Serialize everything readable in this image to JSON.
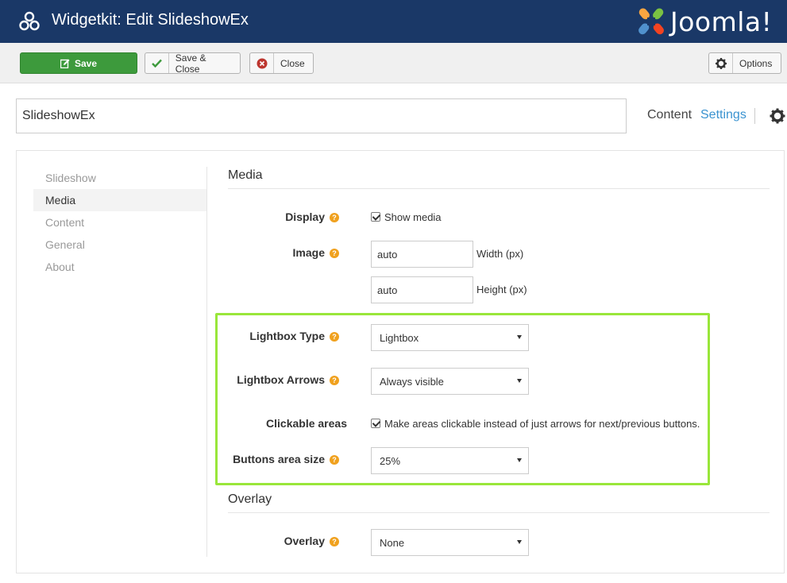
{
  "header": {
    "title": "Widgetkit: Edit SlideshowEx",
    "logo_text": "Joomla!",
    "colors": {
      "bar": "#1a3867",
      "save": "#3d9a3c",
      "link": "#3a93d0",
      "highlight": "#99e63a",
      "help": "#f0a11e"
    }
  },
  "toolbar": {
    "save_label": "Save",
    "save_close_label": "Save & Close",
    "close_label": "Close",
    "options_label": "Options"
  },
  "widget": {
    "name": "SlideshowEx"
  },
  "tabs": {
    "content": "Content",
    "settings": "Settings"
  },
  "sidebar": {
    "items": [
      {
        "label": "Slideshow"
      },
      {
        "label": "Media"
      },
      {
        "label": "Content"
      },
      {
        "label": "General"
      },
      {
        "label": "About"
      }
    ]
  },
  "media": {
    "title": "Media",
    "display_label": "Display",
    "show_media_label": "Show media",
    "image_label": "Image",
    "width_value": "auto",
    "width_unit": "Width (px)",
    "height_value": "auto",
    "height_unit": "Height (px)",
    "lightbox_type_label": "Lightbox Type",
    "lightbox_type_value": "Lightbox",
    "lightbox_arrows_label": "Lightbox Arrows",
    "lightbox_arrows_value": "Always visible",
    "clickable_areas_label": "Clickable areas",
    "clickable_areas_text": "Make areas clickable instead of just arrows for next/previous buttons.",
    "buttons_area_label": "Buttons area size",
    "buttons_area_value": "25%"
  },
  "overlay": {
    "title": "Overlay",
    "overlay_label": "Overlay",
    "overlay_value": "None"
  }
}
